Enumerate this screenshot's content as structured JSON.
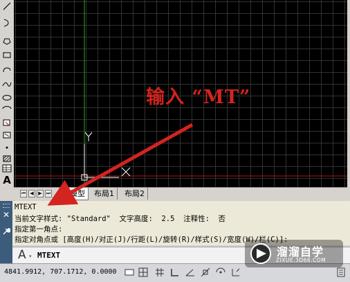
{
  "tabs": {
    "model": "模型",
    "layout1": "布局1",
    "layout2": "布局2"
  },
  "tab_nav_glyphs": [
    "⏮",
    "◀",
    "▶",
    "⏭"
  ],
  "ucs": {
    "y_label": "Y",
    "x_label": "X"
  },
  "annotation": {
    "text": "输入 “MT”",
    "color": "#d3241f"
  },
  "command_history": [
    "MTEXT",
    "当前文字样式: \"Standard\"  文字高度:  2.5  注释性:  否",
    "指定第一角点:",
    "指定对角点或 [高度(H)/对正(J)/行距(L)/旋转(R)/样式(S)/宽度(W)/栏(C)]:"
  ],
  "command_input": {
    "prompt_icon": "A",
    "caret": "▾",
    "text": "MTEXT"
  },
  "command_handle": {
    "close": "✕",
    "properties": "🔧"
  },
  "status": {
    "coordinates": "4841.9912, 707.1712, 0.0000"
  },
  "watermark": {
    "title": "溜溜自学",
    "url": "ZIXUE.3D66.COM"
  },
  "colors": {
    "canvas_bg": "#000000",
    "grid": "#3a3a3a",
    "annotation_red": "#d3241f",
    "command_bg": "#ece9d8",
    "cmd_handle": "#3c5c7c"
  }
}
